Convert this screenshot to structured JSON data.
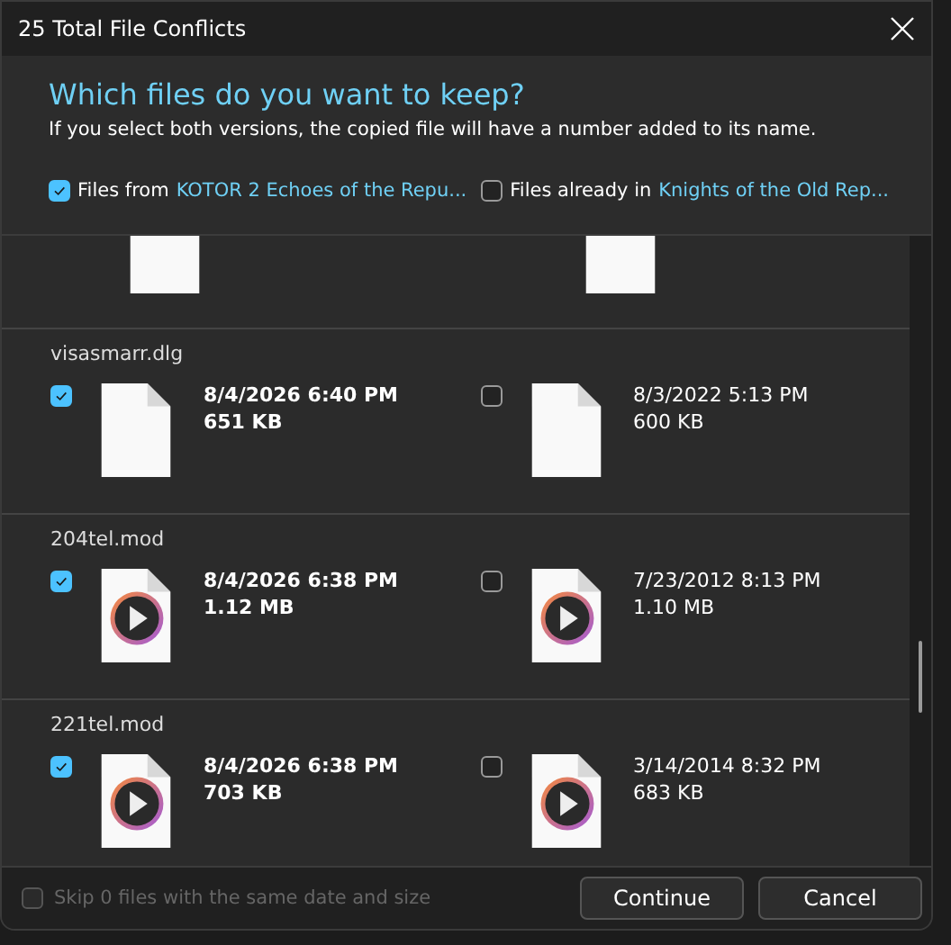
{
  "window": {
    "title": "25 Total File Conflicts"
  },
  "header": {
    "heading": "Which files do you want to keep?",
    "subtitle": "If you select both versions, the copied file will have a number added to its name.",
    "sources": [
      {
        "prefix": "Files from",
        "name": "KOTOR 2 Echoes of the Repu...",
        "checked": true
      },
      {
        "prefix": "Files already in",
        "name": "Knights of the Old Rep...",
        "checked": false
      }
    ]
  },
  "partial_row": [
    {
      "kind": "blank"
    },
    {
      "kind": "blank"
    }
  ],
  "rows": [
    {
      "name": "visasmarr.dlg",
      "left": {
        "checked": true,
        "kind": "blank",
        "date": "8/4/2026 6:40 PM",
        "size": "651 KB"
      },
      "right": {
        "checked": false,
        "kind": "blank",
        "date": "8/3/2022 5:13 PM",
        "size": "600 KB"
      }
    },
    {
      "name": "204tel.mod",
      "left": {
        "checked": true,
        "kind": "media",
        "date": "8/4/2026 6:38 PM",
        "size": "1.12 MB"
      },
      "right": {
        "checked": false,
        "kind": "media",
        "date": "7/23/2012 8:13 PM",
        "size": "1.10 MB"
      }
    },
    {
      "name": "221tel.mod",
      "left": {
        "checked": true,
        "kind": "media",
        "date": "8/4/2026 6:38 PM",
        "size": "703 KB"
      },
      "right": {
        "checked": false,
        "kind": "media",
        "date": "3/14/2014 8:32 PM",
        "size": "683 KB"
      }
    }
  ],
  "skip": {
    "label": "Skip 0 files with the same date and size",
    "checked": false,
    "disabled": true
  },
  "buttons": [
    {
      "label": "Continue"
    },
    {
      "label": "Cancel"
    }
  ]
}
